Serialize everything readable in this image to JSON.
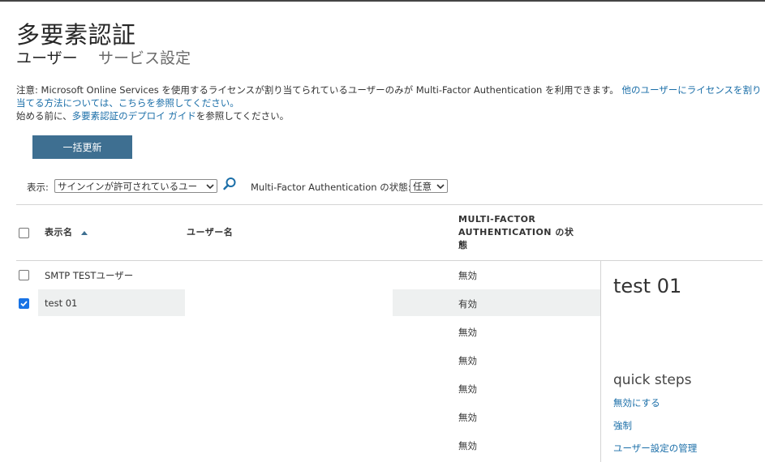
{
  "page": {
    "title": "多要素認証",
    "tabs": [
      {
        "label": "ユーザー",
        "active": true
      },
      {
        "label": "サービス設定",
        "active": false
      }
    ]
  },
  "notice": {
    "line1_text": "注意: Microsoft Online Services を使用するライセンスが割り当てられているユーザーのみが Multi-Factor Authentication を利用できます。",
    "line1_link": "他のユーザーにライセンスを割り当てる方法については、こちらを参照してください。",
    "line2_prefix": "始める前に、",
    "line2_link": "多要素認証のデプロイ ガイド",
    "line2_suffix": "を参照してください。"
  },
  "toolbar": {
    "bulk_update_label": "一括更新"
  },
  "filters": {
    "view_label": "表示:",
    "view_value": "サインインが許可されているユー",
    "mfa_label": "Multi-Factor Authentication の状態:",
    "mfa_value": "任意"
  },
  "table": {
    "headers": {
      "display_name": "表示名",
      "user_name": "ユーザー名",
      "mfa_status_line1": "MULTI-FACTOR",
      "mfa_status_line2": "AUTHENTICATION の状",
      "mfa_status_line3": "態"
    },
    "rows": [
      {
        "display_name": "SMTP TESTユーザー",
        "user_name": "",
        "mfa_status": "無効",
        "checked": false
      },
      {
        "display_name": "test 01",
        "user_name": "",
        "mfa_status": "有効",
        "checked": true
      },
      {
        "display_name": "",
        "user_name": "",
        "mfa_status": "無効",
        "checked": false
      },
      {
        "display_name": "",
        "user_name": "",
        "mfa_status": "無効",
        "checked": false
      },
      {
        "display_name": "",
        "user_name": "",
        "mfa_status": "無効",
        "checked": false
      },
      {
        "display_name": "",
        "user_name": "",
        "mfa_status": "無効",
        "checked": false
      },
      {
        "display_name": "",
        "user_name": "",
        "mfa_status": "無効",
        "checked": false
      }
    ]
  },
  "detail": {
    "selected_name": "test 01",
    "quick_steps_title": "quick steps",
    "quick_steps": [
      {
        "label": "無効にする"
      },
      {
        "label": "強制"
      },
      {
        "label": "ユーザー設定の管理"
      }
    ]
  },
  "colors": {
    "accent_button": "#3e6f91",
    "link": "#1a6ea8",
    "checkbox_checked": "#1873e5",
    "row_highlight": "#eef0f0"
  }
}
